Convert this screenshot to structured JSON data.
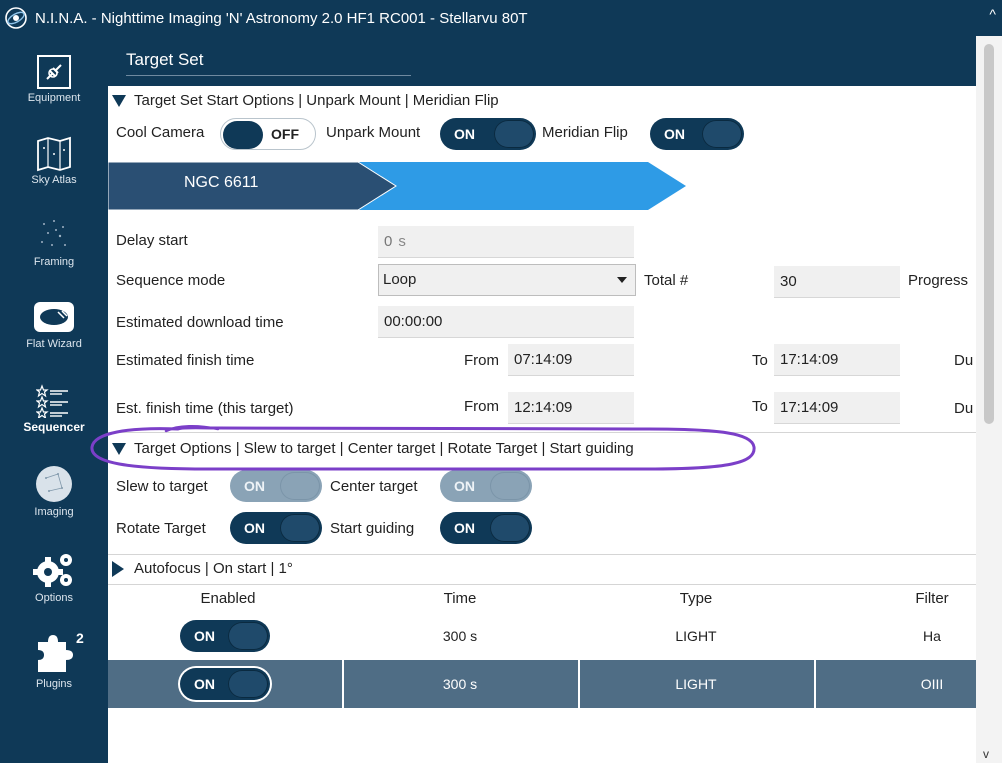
{
  "window": {
    "title": "N.I.N.A. - Nighttime Imaging 'N' Astronomy 2.0 HF1 RC001  -  Stellarvu 80T",
    "icon": "nina-logo-icon",
    "caret": "^",
    "scroll_down": "v"
  },
  "nav": {
    "items": [
      {
        "label": "Equipment",
        "icon": "plug-icon"
      },
      {
        "label": "Sky Atlas",
        "icon": "map-icon"
      },
      {
        "label": "Framing",
        "icon": "stars-icon"
      },
      {
        "label": "Flat Wizard",
        "icon": "flat-panel-icon"
      },
      {
        "label": "Sequencer",
        "icon": "sequence-list-icon"
      },
      {
        "label": "Imaging",
        "icon": "telescope-view-icon"
      },
      {
        "label": "Options",
        "icon": "gears-icon"
      },
      {
        "label": "Plugins",
        "icon": "puzzle-icon",
        "badge": "2"
      }
    ],
    "active": "Sequencer"
  },
  "header": {
    "tab": "Target Set"
  },
  "start_options": {
    "heading": "Target Set Start Options  | Unpark Mount | Meridian Flip",
    "cool_camera_label": "Cool Camera",
    "cool_camera_state": "OFF",
    "unpark_mount_label": "Unpark Mount",
    "unpark_mount_state": "ON",
    "meridian_flip_label": "Meridian Flip",
    "meridian_flip_state": "ON"
  },
  "targets": [
    {
      "name": "NGC 6611",
      "active": true
    },
    {
      "name": "",
      "active": false
    }
  ],
  "colors": {
    "navy": "#0f3957",
    "target_active": "#2a4f73",
    "target_inactive": "#2e9be6",
    "selected_row": "#4f6d85",
    "annotation": "#7b3fc8"
  },
  "details": {
    "delay_label": "Delay start",
    "delay_value": "0",
    "delay_unit": "s",
    "mode_label": "Sequence mode",
    "mode_value": "Loop",
    "total_label": "Total #",
    "total_value": "30",
    "progress_label": "Progress",
    "download_label": "Estimated download time",
    "download_value": "00:00:00",
    "finish_label": "Estimated finish time",
    "finish_from_label": "From",
    "finish_from": "07:14:09",
    "finish_to_label": "To",
    "finish_to": "17:14:09",
    "finish_du": "Du",
    "target_finish_label": "Est. finish time (this target)",
    "target_from_label": "From",
    "target_from": "12:14:09",
    "target_to_label": "To",
    "target_to": "17:14:09",
    "target_du": "Du"
  },
  "target_options": {
    "heading": "Target Options | Slew to target | Center target | Rotate Target | Start guiding",
    "slew_label": "Slew to target",
    "slew_state": "ON",
    "center_label": "Center target",
    "center_state": "ON",
    "rotate_label": "Rotate Target",
    "rotate_state": "ON",
    "guide_label": "Start guiding",
    "guide_state": "ON"
  },
  "autofocus": {
    "heading": "Autofocus | On start | 1°"
  },
  "table": {
    "columns": [
      "Enabled",
      "Time",
      "Type",
      "Filter"
    ],
    "rows": [
      {
        "enabled": "ON",
        "time": "300 s",
        "type": "LIGHT",
        "filter": "Ha",
        "selected": false
      },
      {
        "enabled": "ON",
        "time": "300 s",
        "type": "LIGHT",
        "filter": "OIII",
        "selected": true
      }
    ]
  }
}
